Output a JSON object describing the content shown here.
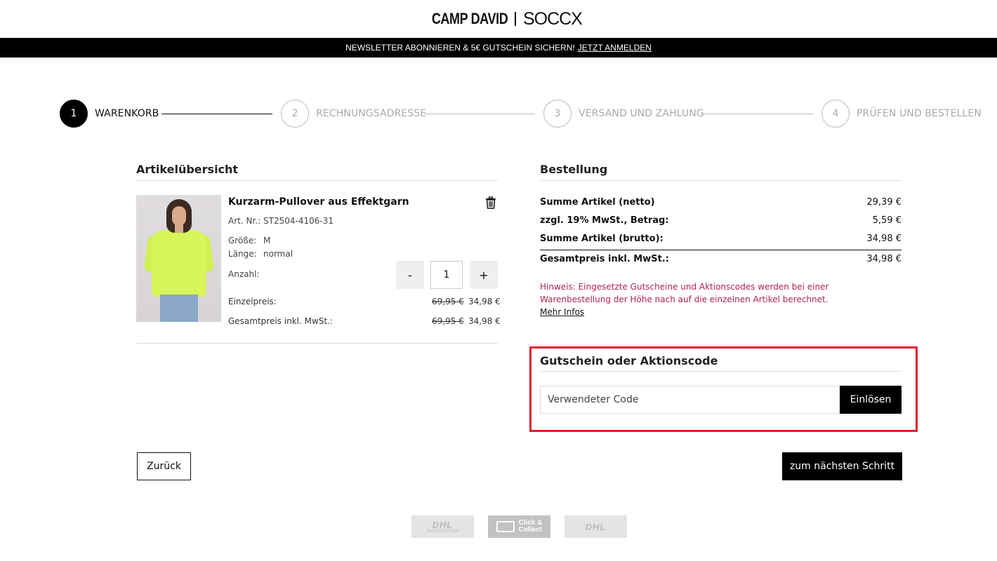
{
  "header": {
    "logo_camp": "CAMP DAVID",
    "logo_soccx": "SOCCX"
  },
  "promo": {
    "text": "NEWSLETTER ABONNIEREN & 5€ GUTSCHEIN SICHERN!",
    "link": "JETZT ANMELDEN"
  },
  "steps": [
    {
      "num": "1",
      "label": "WARENKORB",
      "active": true
    },
    {
      "num": "2",
      "label": "RECHNUNGSADRESSE",
      "active": false
    },
    {
      "num": "3",
      "label": "VERSAND UND ZAHLUNG",
      "active": false
    },
    {
      "num": "4",
      "label": "PRÜFEN UND BESTELLEN",
      "active": false
    }
  ],
  "cart": {
    "title": "Artikelübersicht",
    "product": {
      "name": "Kurzarm-Pullover aus Effektgarn",
      "art_label": "Art. Nr.:",
      "art_value": "ST2504-4106-31",
      "size_label": "Größe:",
      "size_value": "M",
      "length_label": "Länge:",
      "length_value": "normal",
      "qty_label": "Anzahl:",
      "qty_value": "1",
      "qty_minus": "-",
      "qty_plus": "+",
      "unit_label": "Einzelpreis:",
      "unit_old": "69,95 €",
      "unit_new": "34,98 €",
      "total_label": "Gesamtpreis inkl. MwSt.:",
      "total_old": "69,95 €",
      "total_new": "34,98 €"
    }
  },
  "order": {
    "title": "Bestellung",
    "rows": [
      {
        "label": "Summe Artikel (netto)",
        "value": "29,39 €"
      },
      {
        "label": "zzgl. 19% MwSt., Betrag:",
        "value": "5,59 €"
      },
      {
        "label": "Summe Artikel (brutto):",
        "value": "34,98 €"
      }
    ],
    "total_label": "Gesamtpreis inkl. MwSt.:",
    "total_value": "34,98 €",
    "notice": "Hinweis: Eingesetzte Gutscheine und Aktionscodes werden bei einer Warenbestellung der Höhe nach auf die einzelnen Artikel berechnet.",
    "more_info": "Mehr Infos"
  },
  "voucher": {
    "title": "Gutschein oder Aktionscode",
    "placeholder": "Verwendeter Code",
    "button": "Einlösen"
  },
  "nav": {
    "back": "Zurück",
    "next": "zum nächsten Schritt"
  },
  "shipping_logos": {
    "dhl_packstation": "DHL",
    "packstation_sub": "PACKSTATION",
    "click_collect_1": "Click &",
    "click_collect_2": "Collect",
    "dhl": "DHL"
  },
  "colors": {
    "accent": "#000000",
    "notice": "#b0234a",
    "highlight_border": "#e0202e"
  }
}
